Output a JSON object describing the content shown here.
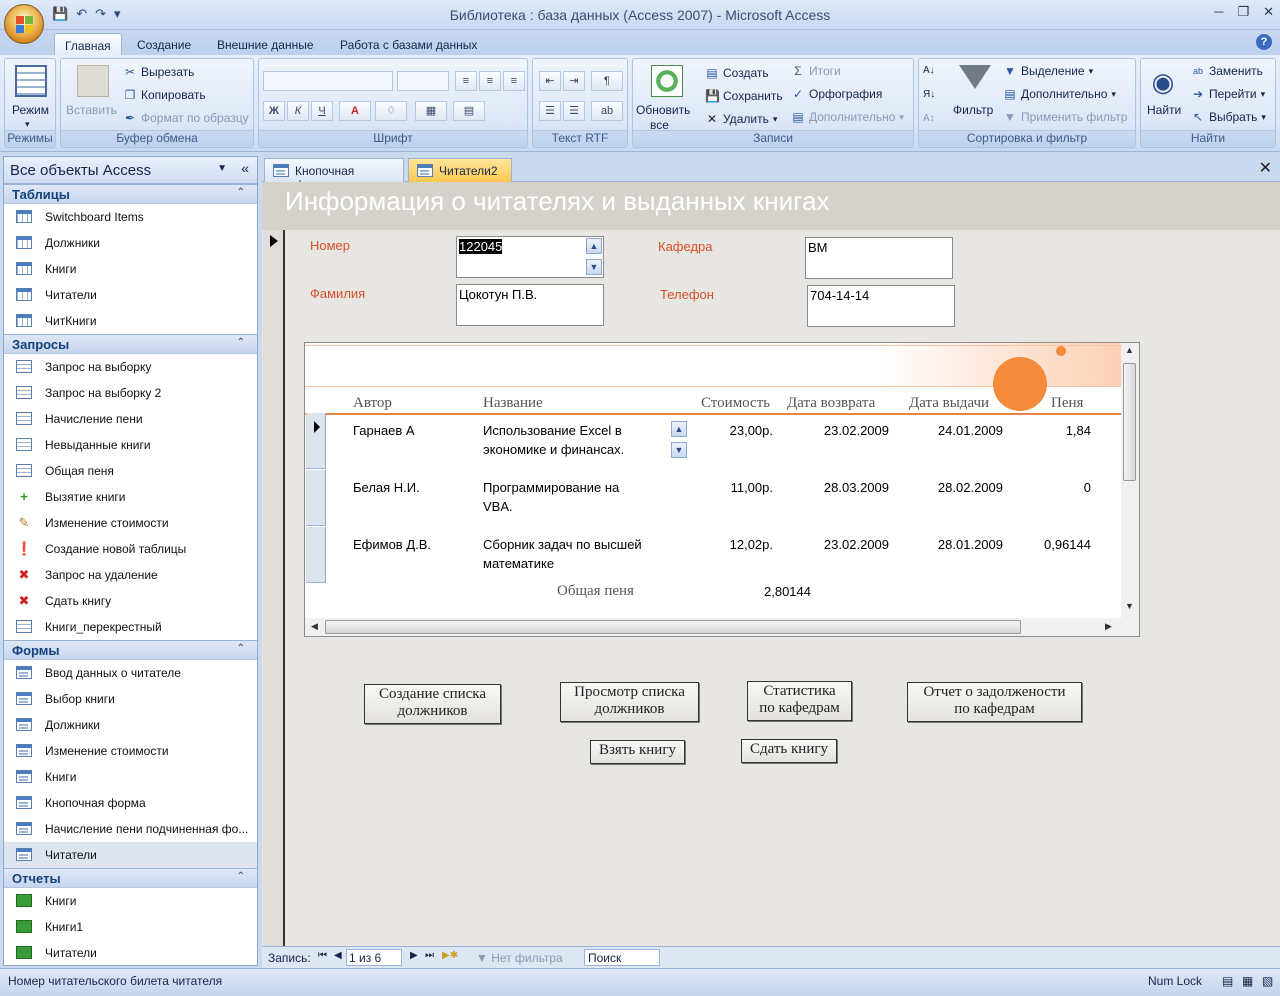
{
  "window": {
    "title": "Библиотека : база данных (Access 2007) - Microsoft Access"
  },
  "ribbon_tabs": [
    "Главная",
    "Создание",
    "Внешние данные",
    "Работа с базами данных"
  ],
  "ribbon": {
    "groups": {
      "modes": "Режимы",
      "clipboard": "Буфер обмена",
      "font": "Шрифт",
      "rtf": "Текст RTF",
      "records": "Записи",
      "sort_filter": "Сортировка и фильтр",
      "find": "Найти"
    },
    "view_btn": "Режим",
    "paste_btn": "Вставить",
    "cut": "Вырезать",
    "copy": "Копировать",
    "format_painter": "Формат по образцу",
    "refresh_line1": "Обновить",
    "refresh_line2": "все",
    "new": "Создать",
    "save": "Сохранить",
    "delete": "Удалить",
    "totals": "Итоги",
    "spelling": "Орфография",
    "more": "Дополнительно",
    "filter_btn": "Фильтр",
    "selection": "Выделение",
    "advanced": "Дополнительно",
    "apply_filter": "Применить фильтр",
    "find_btn": "Найти",
    "replace": "Заменить",
    "goto": "Перейти",
    "select": "Выбрать",
    "bold": "Ж",
    "italic": "К",
    "underline": "Ч"
  },
  "nav": {
    "header": "Все объекты Access",
    "sections": {
      "tables": {
        "title": "Таблицы",
        "items": [
          "Switchboard Items",
          "Должники",
          "Книги",
          "Читатели",
          "ЧитКниги"
        ]
      },
      "queries": {
        "title": "Запросы",
        "items": [
          "Запрос на выборку",
          "Запрос на выборку 2",
          "Начисление пени",
          "Невыданные книги",
          "Общая пеня",
          "Вызятие книги",
          "Изменение стоимости",
          "Создание новой таблицы",
          "Запрос на удаление",
          "Сдать книгу",
          "Книги_перекрестный"
        ]
      },
      "forms": {
        "title": "Формы",
        "items": [
          "Ввод данных о читателе",
          "Выбор книги",
          "Должники",
          "Изменение стоимости",
          "Книги",
          "Кнопочная форма",
          "Начисление пени подчиненная фо...",
          "Читатели"
        ]
      },
      "reports": {
        "title": "Отчеты",
        "items": [
          "Книги",
          "Книги1",
          "Читатели"
        ]
      }
    }
  },
  "doc_tabs": [
    "Кнопочная форма",
    "Читатели2"
  ],
  "form": {
    "title": "Информация о читателях и выданных книгах",
    "labels": {
      "number": "Номер",
      "surname": "Фамилия",
      "department": "Кафедра",
      "phone": "Телефон"
    },
    "values": {
      "number": "122045",
      "surname": "Цокотун П.В.",
      "department": "ВМ",
      "phone": "704-14-14"
    }
  },
  "subform": {
    "headers": [
      "Автор",
      "Название",
      "Стоимость",
      "Дата возврата",
      "Дата выдачи",
      "Пеня"
    ],
    "rows": [
      {
        "author": "Гарнаев А",
        "title1": "Использование Excel в",
        "title2": "экономике и финансах.",
        "cost": "23,00р.",
        "return": "23.02.2009",
        "issue": "24.01.2009",
        "fine": "1,84"
      },
      {
        "author": "Белая Н.И.",
        "title1": "Программирование на",
        "title2": "VBA.",
        "cost": "11,00р.",
        "return": "28.03.2009",
        "issue": "28.02.2009",
        "fine": "0"
      },
      {
        "author": "Ефимов Д.В.",
        "title1": "Сборник задач по высшей",
        "title2": "математике",
        "cost": "12,02р.",
        "return": "23.02.2009",
        "issue": "28.01.2009",
        "fine": "0,96144"
      }
    ],
    "total_label": "Общая пеня",
    "total_value": "2,80144"
  },
  "buttons": {
    "create_debtors_1": "Создание списка",
    "create_debtors_2": "должников",
    "view_debtors_1": "Просмотр списка",
    "view_debtors_2": "должников",
    "stats_1": "Статистика",
    "stats_2": "по кафедрам",
    "report_1": "Отчет о задолжености",
    "report_2": "по кафедрам",
    "take_book": "Взять книгу",
    "return_book": "Сдать книгу"
  },
  "record_nav": {
    "label": "Запись:",
    "position": "1 из 6",
    "filter": "Нет фильтра",
    "search": "Поиск"
  },
  "status": {
    "text": "Номер читательского билета читателя",
    "numlock": "Num Lock"
  },
  "colors": {
    "accent_orange": "#f58a3a",
    "label_red": "#d4502a",
    "active_tab": "#fbc84e"
  }
}
